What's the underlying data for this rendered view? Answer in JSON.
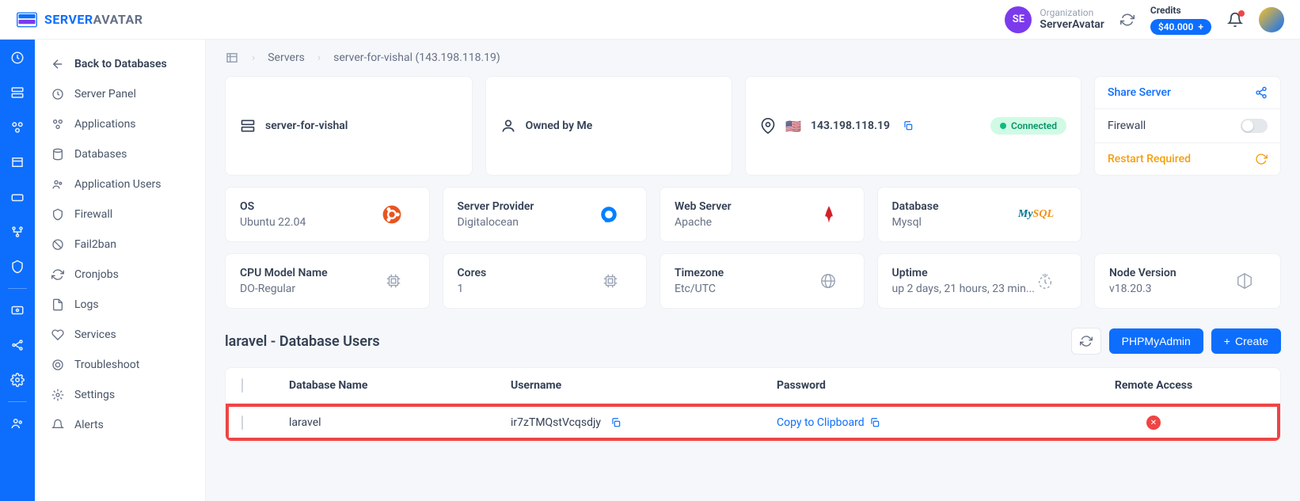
{
  "brand": {
    "text1": "SERVER",
    "text2": "AVATAR"
  },
  "header": {
    "org_initials": "SE",
    "org_label": "Organization",
    "org_name": "ServerAvatar",
    "credits_label": "Credits",
    "credits_value": "$40.000"
  },
  "sidebar": {
    "back": "Back to Databases",
    "items": [
      "Server Panel",
      "Applications",
      "Databases",
      "Application Users",
      "Firewall",
      "Fail2ban",
      "Cronjobs",
      "Logs",
      "Services",
      "Troubleshoot",
      "Settings",
      "Alerts"
    ]
  },
  "breadcrumb": {
    "servers": "Servers",
    "current": "server-for-vishal (143.198.118.19)"
  },
  "info": {
    "server_name": "server-for-vishal",
    "owned": "Owned by Me",
    "ip": "143.198.118.19",
    "connected": "Connected",
    "share": "Share Server",
    "firewall": "Firewall",
    "restart": "Restart Required"
  },
  "stats": {
    "os_label": "OS",
    "os_value": "Ubuntu 22.04",
    "provider_label": "Server Provider",
    "provider_value": "Digitalocean",
    "web_label": "Web Server",
    "web_value": "Apache",
    "db_label": "Database",
    "db_value": "Mysql",
    "cpu_label": "CPU Model Name",
    "cpu_value": "DO-Regular",
    "cores_label": "Cores",
    "cores_value": "1",
    "tz_label": "Timezone",
    "tz_value": "Etc/UTC",
    "uptime_label": "Uptime",
    "uptime_value": "up 2 days, 21 hours, 23 min...",
    "node_label": "Node Version",
    "node_value": "v18.20.3"
  },
  "section": {
    "title": "laravel - Database Users",
    "btn_php": "PHPMyAdmin",
    "btn_create": "Create"
  },
  "table": {
    "headers": {
      "db": "Database Name",
      "user": "Username",
      "pass": "Password",
      "remote": "Remote Access"
    },
    "rows": [
      {
        "db": "laravel",
        "user": "ir7zTMQstVcqsdjy",
        "pass_action": "Copy to Clipboard"
      }
    ]
  }
}
